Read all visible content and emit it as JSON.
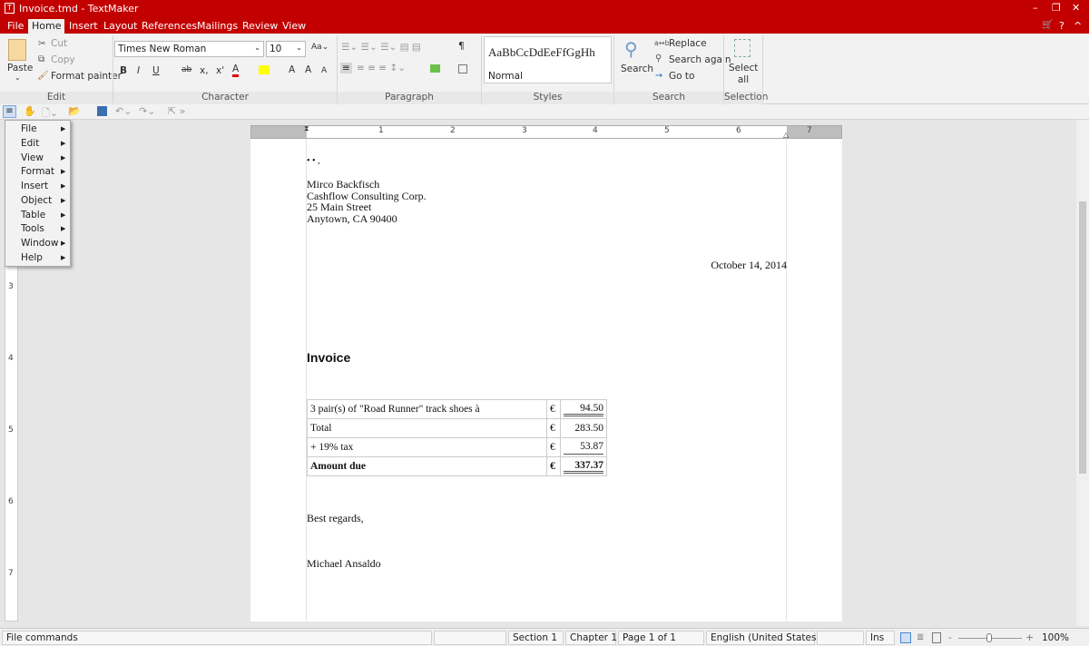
{
  "window": {
    "title": "Invoice.tmd - TextMaker",
    "controls": [
      "–",
      "❐",
      "✕"
    ],
    "right_icons": [
      "cart-icon",
      "help-icon",
      "collapse-ribbon-icon"
    ]
  },
  "tabs": [
    "File",
    "Home",
    "Insert",
    "Layout",
    "References",
    "Mailings",
    "Review",
    "View"
  ],
  "active_tab": "Home",
  "ribbon": {
    "edit": {
      "label": "Edit",
      "paste": "Paste",
      "cut": "Cut",
      "copy": "Copy",
      "format_painter": "Format painter"
    },
    "character": {
      "label": "Character",
      "font": "Times New Roman",
      "size": "10",
      "bold": "B",
      "italic": "I",
      "underline": "U",
      "strike": "ab",
      "sub": "x,",
      "sup": "x'",
      "fontcolor": "A",
      "grow": "A",
      "shrink": "A"
    },
    "paragraph": {
      "label": "Paragraph",
      "pilcrow": "¶"
    },
    "styles": {
      "label": "Styles",
      "preview": "AaBbCcDdEeFfGgHh",
      "current": "Normal"
    },
    "search": {
      "label": "Search",
      "search": "Search",
      "replace": "Replace",
      "search_again": "Search again",
      "go_to": "Go to"
    },
    "selection": {
      "label": "Selection",
      "select_all": "Select all"
    }
  },
  "colors": {
    "brand": "#c30000",
    "font_color": "#e00000",
    "highlight": "#ffff00",
    "shading": "#6cc04a"
  },
  "menu": {
    "items": [
      "File",
      "Edit",
      "View",
      "Format",
      "Insert",
      "Object",
      "Table",
      "Tools",
      "Window",
      "Help"
    ]
  },
  "ruler": {
    "h_numbers": [
      "1",
      "2",
      "3",
      "4",
      "5",
      "6",
      "7"
    ],
    "v_numbers": [
      "3",
      "4",
      "5",
      "6",
      "7"
    ]
  },
  "document": {
    "marks": "• • ,",
    "address": [
      "Mirco Backfisch",
      "Cashflow Consulting Corp.",
      "25 Main Street",
      "Anytown, CA 90400"
    ],
    "date": "October 14, 2014",
    "heading": "Invoice",
    "table": [
      {
        "desc": "3 pair(s) of \"Road Runner\" track shoes à",
        "cur": "€",
        "amount": "94.50"
      },
      {
        "desc": "Total",
        "cur": "€",
        "amount": "283.50"
      },
      {
        "desc": "+ 19% tax",
        "cur": "€",
        "amount": "53.87"
      },
      {
        "desc": "Amount due",
        "cur": "€",
        "amount": "337.37"
      }
    ],
    "closing": "Best regards,",
    "signature": "Michael Ansaldo"
  },
  "status": {
    "hint": "File commands",
    "section": "Section 1",
    "chapter": "Chapter 1",
    "page": "Page 1 of 1",
    "language": "English (United States)",
    "mode": "Ins",
    "zoom": "100%",
    "zoom_level": 100
  }
}
